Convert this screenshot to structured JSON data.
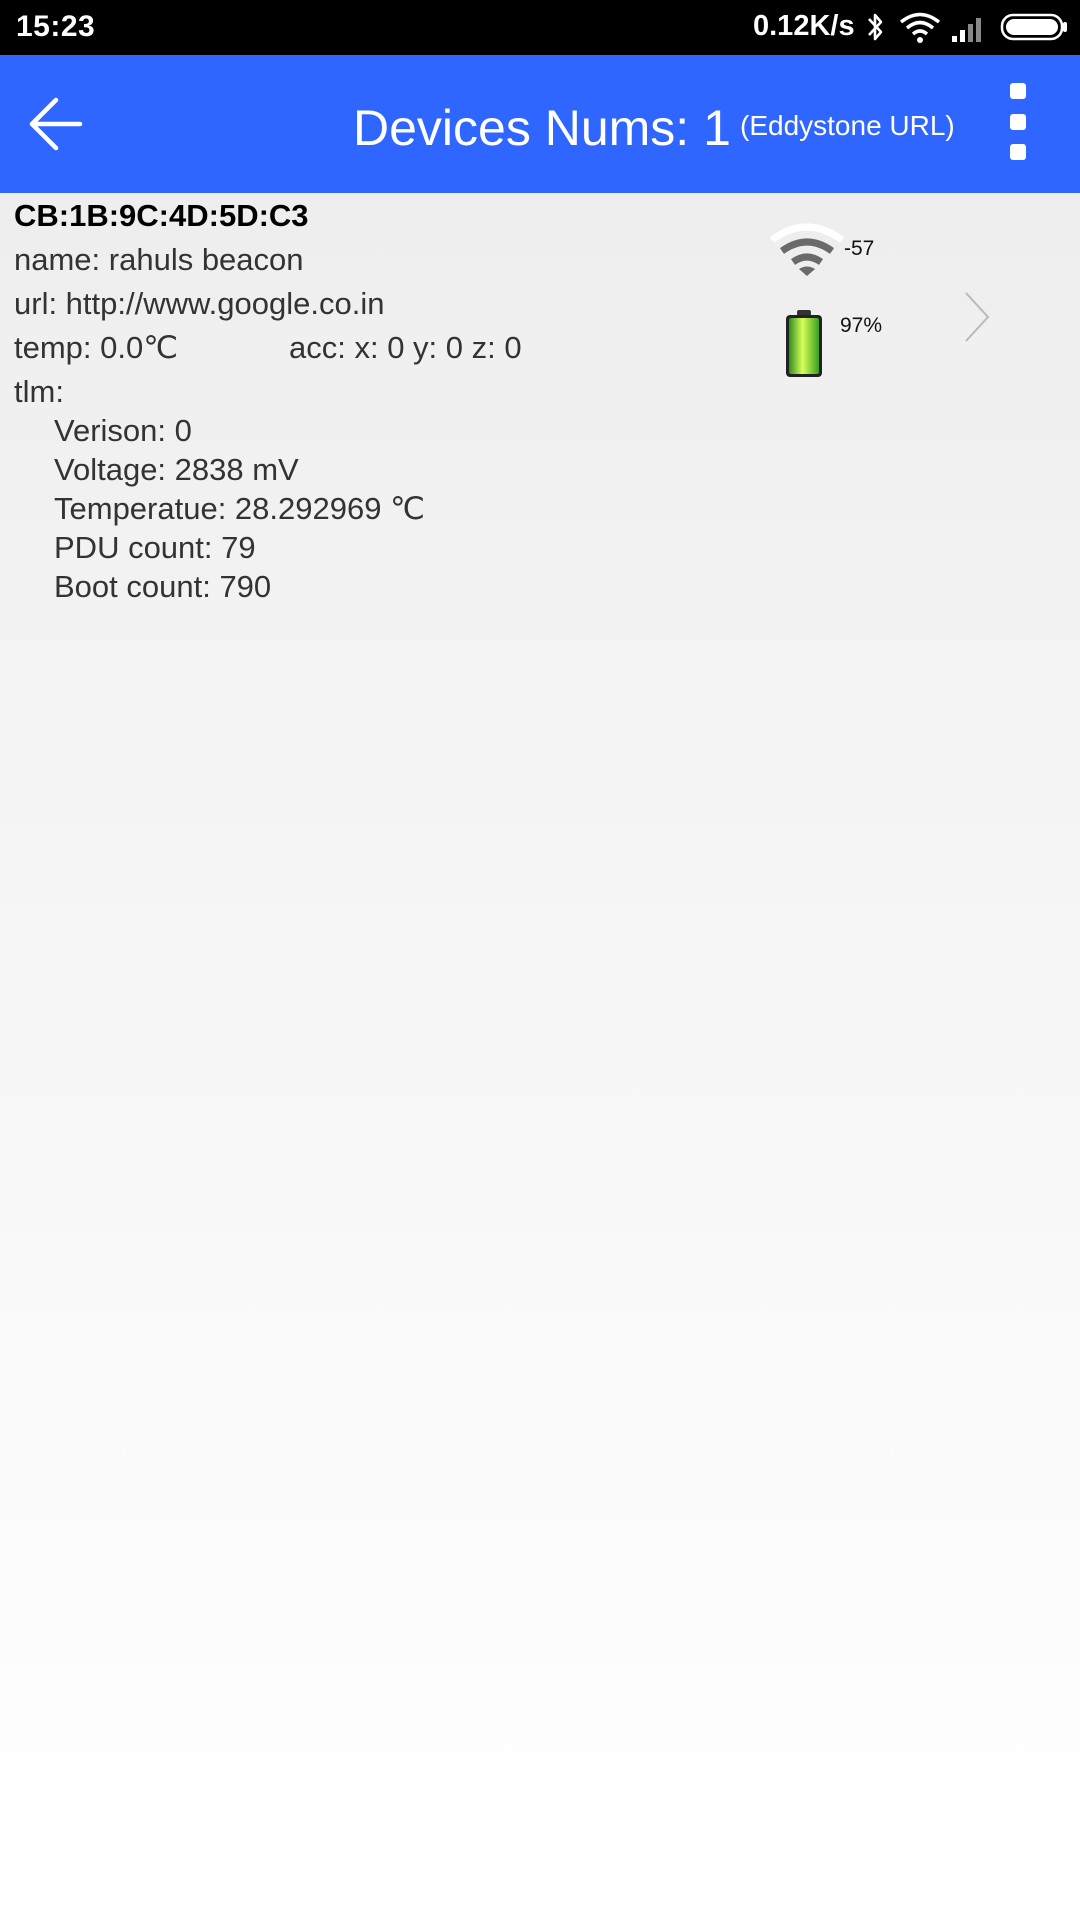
{
  "status_bar": {
    "time": "15:23",
    "net_speed": "0.12K/s",
    "icons": [
      "bluetooth-icon",
      "wifi-icon",
      "cell-signal-icon",
      "battery-icon"
    ]
  },
  "app_bar": {
    "title": "Devices Nums: 1",
    "subtitle": "(Eddystone URL)",
    "accent_color": "#2f66ff"
  },
  "device": {
    "mac": "CB:1B:9C:4D:5D:C3",
    "name": "name: rahuls beacon",
    "url": "url: http://www.google.co.in",
    "temp": "temp: 0.0℃",
    "acc": "acc: x: 0  y: 0  z: 0",
    "tlm_label": "tlm:",
    "tlm": {
      "version": "Verison: 0",
      "voltage": "Voltage: 2838 mV",
      "temperature": "Temperatue: 28.292969 ℃",
      "pdu_count": "PDU count: 79",
      "boot_count": "Boot count: 790"
    },
    "rssi": "-57",
    "battery": "97%"
  }
}
